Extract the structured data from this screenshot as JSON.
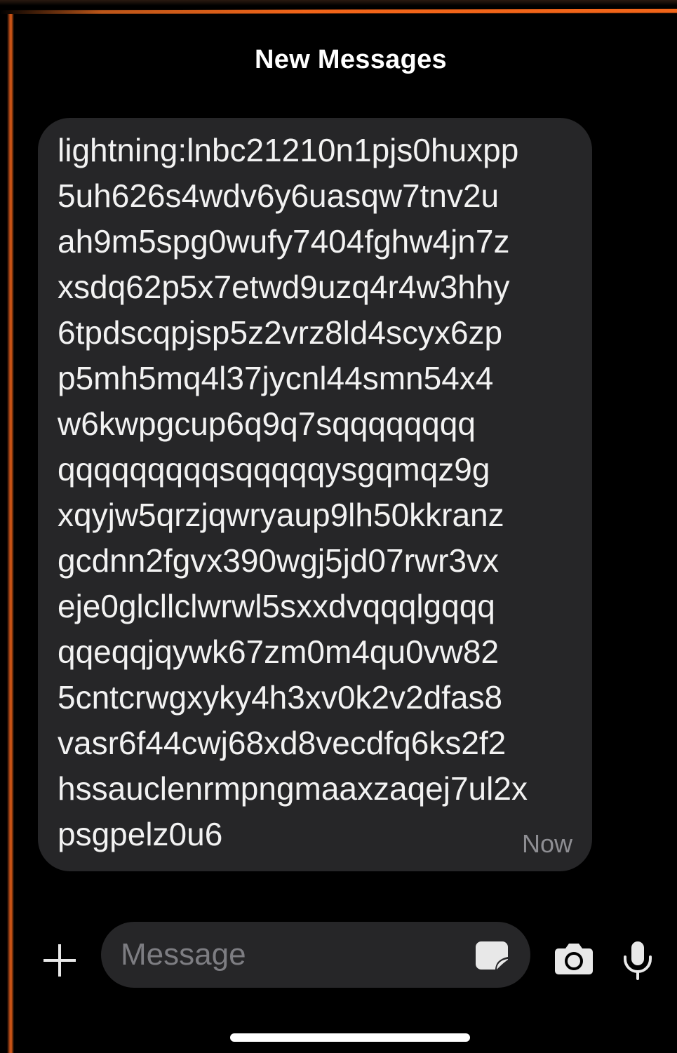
{
  "header": {
    "title": "New Messages"
  },
  "message": {
    "text": "lightning:lnbc21210n1pjs0huxpp\n5uh626s4wdv6y6uasqw7tnv2u\nah9m5spg0wufy7404fghw4jn7z\nxsdq62p5x7etwd9uzq4r4w3hhy\n6tpdscqpjsp5z2vrz8ld4scyx6zp\np5mh5mq4l37jycnl44smn54x4\nw6kwpgcup6q9q7sqqqqqqqq\nqqqqqqqqqsqqqqqysgqmqz9g\nxqyjw5qrzjqwryaup9lh50kkranz\ngcdnn2fgvx390wgj5jd07rwr3vx\neje0glcllclwrwl5sxxdvqqqlgqqq\nqqeqqjqywk67zm0m4qu0vw82\n5cntcrwgxyky4h3xv0k2v2dfas8\nvasr6f44cwj68xd8vecdfq6ks2f2\nhssauclenrmpngmaaxzaqej7ul2x\npsgpelz0u6",
    "timestamp": "Now"
  },
  "compose": {
    "placeholder": "Message",
    "value": ""
  },
  "icons": {
    "add": "plus-icon",
    "sticker": "sticker-icon",
    "camera": "camera-icon",
    "mic": "microphone-icon"
  },
  "colors": {
    "background": "#000000",
    "bubble": "#262628",
    "accent_frame": "#ff6a1a",
    "muted_text": "#8e8e93"
  }
}
